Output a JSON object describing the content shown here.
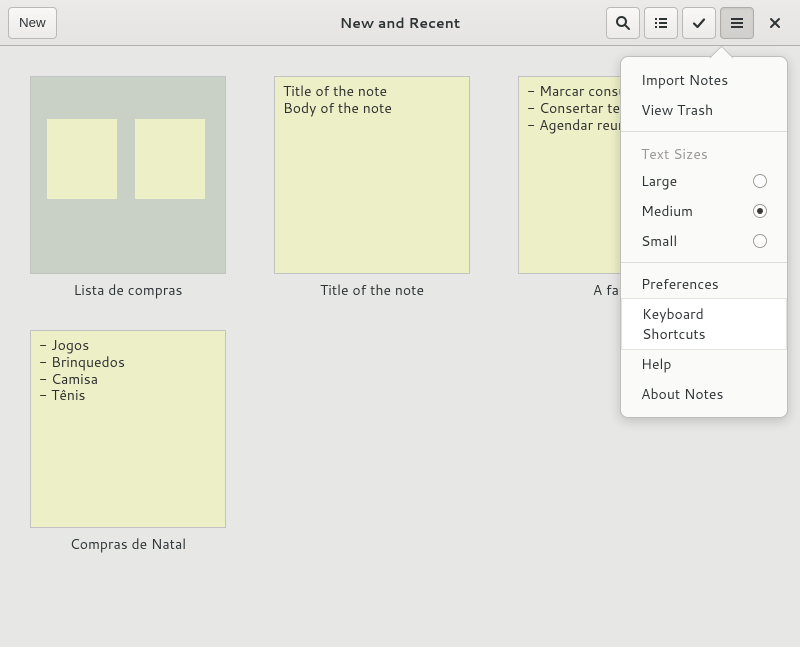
{
  "header": {
    "new_label": "New",
    "title": "New and Recent"
  },
  "notes": [
    {
      "type": "notebook",
      "title": "Lista de compras",
      "body": ""
    },
    {
      "type": "single",
      "title": "Title of the note",
      "body": "Title of the note\nBody of the note"
    },
    {
      "type": "single",
      "title": "A fazer",
      "body": "- Marcar consulta dentista\n- Consertar telefone\n- Agendar reunião"
    },
    {
      "type": "single",
      "title": "Compras de Natal",
      "body": "- Jogos\n- Brinquedos\n- Camisa\n- Tênis"
    }
  ],
  "menu": {
    "import_label": "Import Notes",
    "view_trash_label": "View Trash",
    "text_sizes_header": "Text Sizes",
    "size_large": "Large",
    "size_medium": "Medium",
    "size_small": "Small",
    "selected_size": "Medium",
    "preferences_label": "Preferences",
    "keyboard_shortcuts_label": "Keyboard Shortcuts",
    "help_label": "Help",
    "about_label": "About Notes"
  }
}
